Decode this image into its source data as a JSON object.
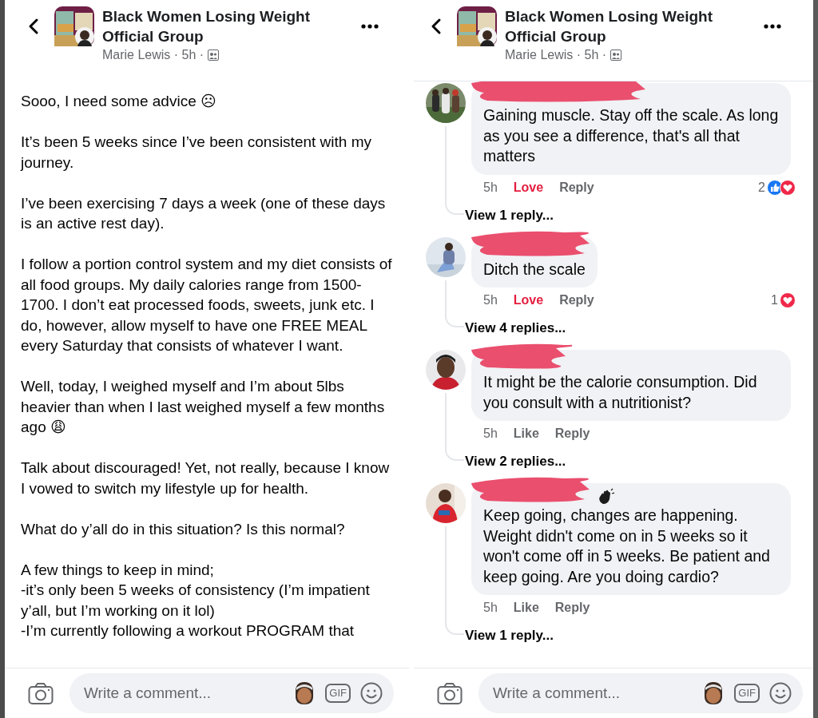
{
  "panels": [
    {
      "kind": "post",
      "header": {
        "title": "Black Women Losing Weight Official Group",
        "byline": "Marie Lewis · 5h ·"
      },
      "paragraphs": [
        {
          "text": "Sooo, I need some advice ☹"
        },
        {
          "text": "It’s been 5 weeks since I’ve been consistent with my journey."
        },
        {
          "text": "I’ve been exercising 7 days a week (one of these days is an active rest day)."
        },
        {
          "text": "I follow a portion control system and my diet consists of all food groups. My daily calories range from 1500-1700. I don’t eat processed foods, sweets, junk etc. I do, however, allow myself to have one FREE MEAL every Saturday that consists of whatever I want."
        },
        {
          "text": "Well, today, I weighed myself and I’m about 5lbs heavier than when I last weighed myself a few months ago 😩"
        },
        {
          "text": "Talk about discouraged! Yet, not really, because I know I vowed to switch my lifestyle up for health."
        },
        {
          "text": "What do y’all do in this situation? Is this normal?"
        },
        {
          "text": "A few things to keep in mind;\n-it’s only been 5 weeks of consistency (I’m impatient y’all, but I’m working on it lol)\n-I’m currently following a workout PROGRAM that"
        }
      ],
      "composer": {
        "placeholder": "Write a comment...",
        "gif": "GIF"
      }
    },
    {
      "kind": "comments",
      "header": {
        "title": "Black Women Losing Weight Official Group",
        "byline": "Marie Lewis · 5h ·"
      },
      "comments": [
        {
          "name_redacted": true,
          "name_emoji": false,
          "text": "Gaining muscle. Stay off the scale. As long as you see a difference, that's all that matters",
          "time": "5h",
          "reaction_label": "Love",
          "reacted": true,
          "reply_label": "Reply",
          "count": "2",
          "reactions": [
            {
              "kind": "like"
            },
            {
              "kind": "love"
            }
          ],
          "view_replies": "View 1 reply..."
        },
        {
          "name_redacted": true,
          "name_emoji": false,
          "text": "Ditch the scale",
          "time": "5h",
          "reaction_label": "Love",
          "reacted": true,
          "reply_label": "Reply",
          "count": "1",
          "reactions": [
            {
              "kind": "love"
            }
          ],
          "view_replies": "View 4 replies..."
        },
        {
          "name_redacted": true,
          "name_emoji": false,
          "text": "It might be the calorie consumption. Did you consult with a nutritionist?",
          "time": "5h",
          "reaction_label": "Like",
          "reacted": false,
          "reply_label": "Reply",
          "view_replies": "View 2 replies..."
        },
        {
          "name_redacted": true,
          "name_emoji": true,
          "text": "Keep going, changes are happening. Weight didn't come on in 5 weeks so it won't come off in 5 weeks. Be patient and keep going. Are you doing cardio?",
          "time": "5h",
          "reaction_label": "Like",
          "reacted": false,
          "reply_label": "Reply",
          "view_replies": "View 1 reply..."
        }
      ],
      "composer": {
        "placeholder": "Write a comment...",
        "gif": "GIF"
      }
    }
  ]
}
